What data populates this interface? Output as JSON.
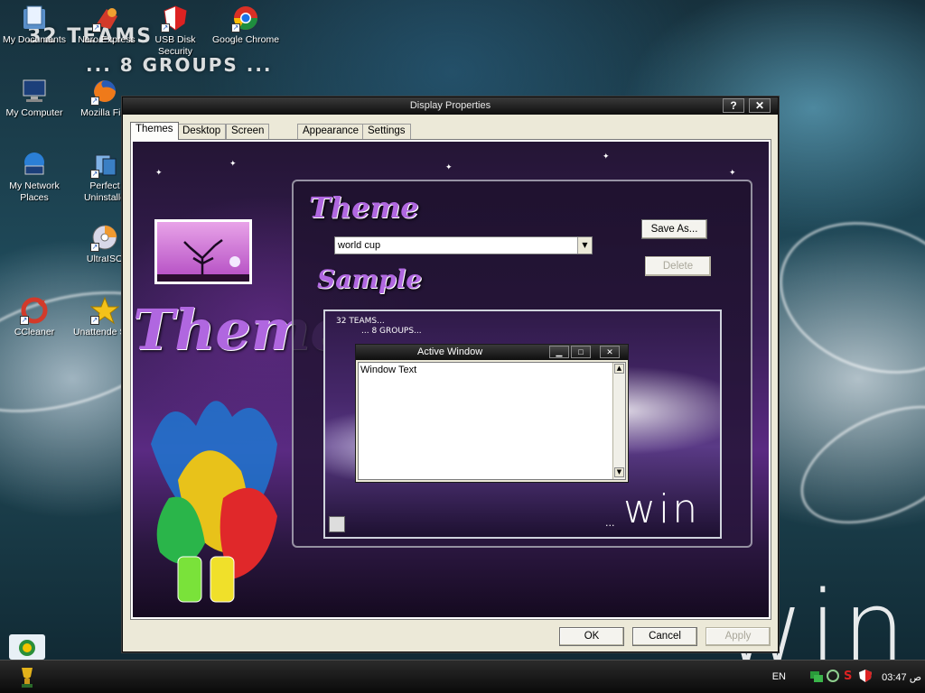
{
  "wallpaper": {
    "line1": "32 TEAMS",
    "line2": "... 8 GROUPS ...",
    "brand": "win"
  },
  "desktop_icons": [
    {
      "label": "My Documents",
      "icon": "folder-icon"
    },
    {
      "label": "Nero Express",
      "icon": "nero-icon"
    },
    {
      "label": "USB Disk Security",
      "icon": "usb-shield-icon"
    },
    {
      "label": "Google Chrome",
      "icon": "chrome-icon"
    },
    {
      "label": "My Computer",
      "icon": "computer-icon"
    },
    {
      "label": "Mozilla Fire",
      "icon": "firefox-icon"
    },
    {
      "label": "My Network Places",
      "icon": "network-icon"
    },
    {
      "label": "Perfect Uninstalle",
      "icon": "uninstaller-icon"
    },
    {
      "label": "UltraISO",
      "icon": "disc-icon"
    },
    {
      "label": "CCleaner",
      "icon": "ccleaner-icon"
    },
    {
      "label": "Unattende Soft",
      "icon": "star-icon"
    }
  ],
  "dialog": {
    "title": "Display Properties",
    "help_label": "?",
    "close_label": "✕",
    "tabs": [
      "Themes",
      "Desktop",
      "Screen Saver",
      "Appearance",
      "Settings"
    ],
    "active_tab": "Themes",
    "side_title": "Themes",
    "theme_heading": "Theme",
    "theme_value": "world cup",
    "save_as_label": "Save As...",
    "delete_label": "Delete",
    "sample_heading": "Sample",
    "sample": {
      "line1": "32 TEAMS...",
      "line2": "... 8 GROUPS...",
      "active_window_title": "Active Window",
      "window_text": "Window Text",
      "footer_text": "...",
      "brand": "win"
    },
    "ok_label": "OK",
    "cancel_label": "Cancel",
    "apply_label": "Apply"
  },
  "taskbar": {
    "language": "EN",
    "clock": "03:47 ص"
  },
  "colors": {
    "accent_purple": "#b067e0",
    "titlebar": "#111111",
    "dialog_face": "#ece9d8"
  }
}
